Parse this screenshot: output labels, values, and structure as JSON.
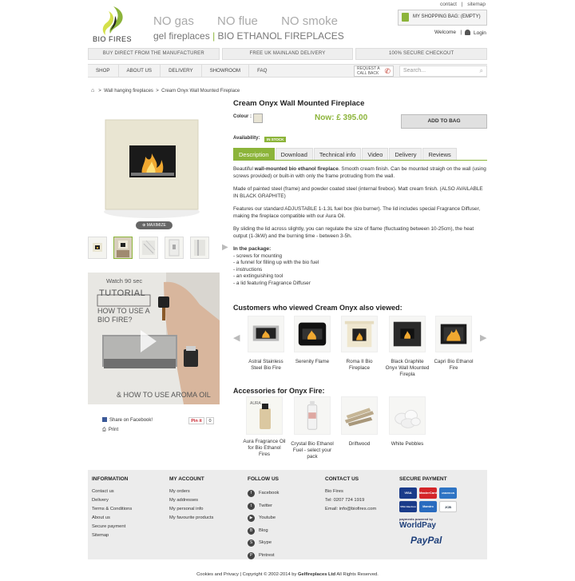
{
  "top_links": {
    "contact": "contact",
    "sep": "|",
    "sitemap": "sitemap"
  },
  "logo": {
    "text": "BIO FIRES"
  },
  "tagline": {
    "gas": "NO gas",
    "flue": "NO flue",
    "smoke": "NO smoke",
    "brand1": "gel fireplaces",
    "sep": "|",
    "brand2": "BIO ETHANOL FIREPLACES"
  },
  "shopping_bag": {
    "label": "MY SHOPPING BAG: (EMPTY)"
  },
  "account": {
    "welcome": "Welcome",
    "sep": "|",
    "login": "Login"
  },
  "promos": [
    "BUY DIRECT FROM THE MANUFACTURER",
    "FREE UK MAINLAND DELIVERY",
    "100% SECURE CHECKOUT"
  ],
  "nav": {
    "items": [
      "SHOP",
      "ABOUT US",
      "DELIVERY",
      "SHOWROOM",
      "FAQ"
    ],
    "callback": "REQUEST A CALL BACK",
    "search_placeholder": "Search..."
  },
  "breadcrumb": {
    "sep1": ">",
    "cat": "Wall hanging fireplaces",
    "sep2": ">",
    "current": "Cream Onyx Wall Mounted Fireplace"
  },
  "gallery": {
    "maximize": "MAXIMIZE"
  },
  "video": {
    "watch": "Watch 90 sec",
    "tutorial": "TUTORIAL",
    "how_line1": "HOW TO USE A",
    "how_line2": "BIO FIRE?",
    "aroma": "& HOW TO USE AROMA OIL"
  },
  "social_share": {
    "facebook": "Share on Facebook!",
    "print": "Print",
    "pinit": "Pin it",
    "pin_count": "0"
  },
  "product": {
    "title": "Cream Onyx Wall Mounted Fireplace",
    "colour_label": "Colour :",
    "price": "Now: £ 395.00",
    "add_to_bag": "ADD TO BAG",
    "availability_label": "Availability:",
    "stock": "IN STOCK",
    "colours": {
      "swatch": "#e8e4d4",
      "accent": "#8cb43a"
    }
  },
  "tabs": [
    "Description",
    "Download",
    "Technical info",
    "Video",
    "Delivery",
    "Reviews"
  ],
  "description": {
    "p1_pre": "Beautiful ",
    "p1_bold": "wall-mounted bio ethanol fireplace",
    "p1_post": ". Smooth cream finish. Can be mounted straigh on the wall (using screws provided) or built-in with only the frame protruding from the wall.",
    "p2": "Made of painted steel (frame) and powder coated steel (internal firebox). Matt cream finish. (ALSO AVAILABLE IN BLACK GRAPHITE)",
    "p3": "Features our standard ADJUSTABLE 1-1.3L fuel box (bio burner). The lid includes special Fragrance Diffuser, making the fireplace compatible with our Aura Oil.",
    "p4": "By sliding the lid across slightly, you can regulate the size of flame (fluctuating between 10-25cm), the heat output (1-3kW) and the burning time - between 3-5h.",
    "package_title": "In the package:",
    "package": [
      "- screws for mounting",
      "- a funnel for filling up with the bio fuel",
      "- instructions",
      "- an extinguishing tool",
      "- a lid featuring Fragrance Diffuser"
    ]
  },
  "also_viewed": {
    "title": "Customers who viewed Cream Onyx also viewed:",
    "items": [
      "Astral Stainless Steel Bio Fire",
      "Serenity Flame",
      "Roma II Bio Fireplace",
      "Black Graphite Onyx Wall Mounted Firepla",
      "Capri Bio Ethanol Fire"
    ]
  },
  "accessories": {
    "title": "Accessories for Onyx Fire:",
    "items": [
      "Aura Fragrance Oil for Bio Ethanol Fires",
      "Crystal Bio Ethanol Fuel - select your pack",
      "Driftwood",
      "White Pebbles"
    ],
    "aura_label": "AURA"
  },
  "footer": {
    "information": {
      "title": "INFORMATION",
      "links": [
        "Contact us",
        "Delivery",
        "Terms & Conditions",
        "About us",
        "Secure payment",
        "Sitemap"
      ]
    },
    "my_account": {
      "title": "MY ACCOUNT",
      "links": [
        "My orders",
        "My addresses",
        "My personal info",
        "My favourite products"
      ]
    },
    "follow_us": {
      "title": "FOLLOW US",
      "links": [
        "Facebook",
        "Twitter",
        "Youtube",
        "Blog",
        "Skype",
        "Pintrest"
      ]
    },
    "contact": {
      "title": "CONTACT US",
      "company": "Bio Fires",
      "tel": "Tel: 0207 724 1919",
      "email": "Email: info@biofires.com"
    },
    "secure": {
      "title": "SECURE PAYMENT",
      "cards": [
        "VISA",
        "MasterCard",
        "AMERICAN EXPRESS",
        "",
        "VISA Electron",
        "Maestro",
        "JCB"
      ],
      "worldpay_small": "payments powered by",
      "worldpay": "WorldPay",
      "paypal": "PayPal"
    }
  },
  "copyright": {
    "pre": "Cookies and Privacy | Copyright © 2002-2014 by ",
    "bold": "Gelfireplaces Ltd",
    "post": " All Rights Reserved."
  }
}
